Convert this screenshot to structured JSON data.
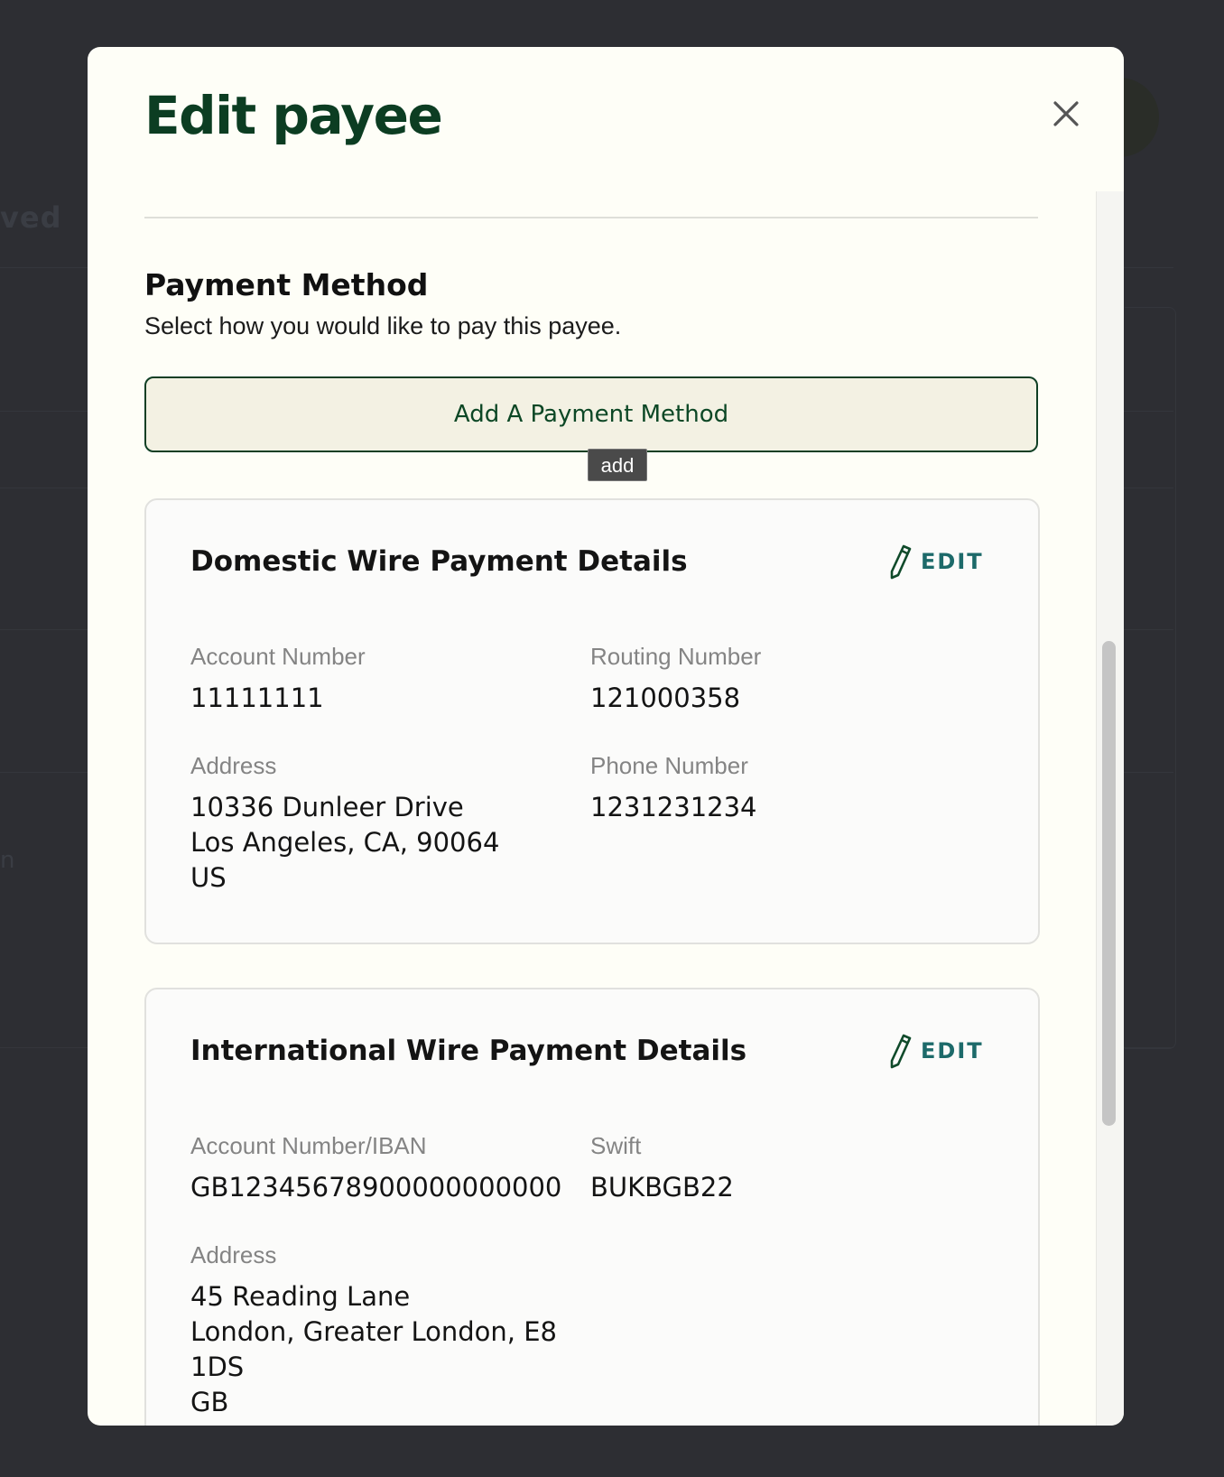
{
  "background": {
    "ghost_text_top": "ved",
    "ghost_text_mid": "n"
  },
  "modal": {
    "title": "Edit payee",
    "close_icon": "close-icon"
  },
  "payment_method": {
    "title": "Payment Method",
    "subtitle": "Select how you would like to pay this payee.",
    "add_button_label": "Add A Payment Method",
    "tooltip": "add"
  },
  "domestic": {
    "title": "Domestic Wire Payment Details",
    "edit_label": "EDIT",
    "account_label": "Account Number",
    "account_value": "11111111",
    "routing_label": "Routing Number",
    "routing_value": "121000358",
    "address_label": "Address",
    "address_line1": "10336 Dunleer Drive",
    "address_line2": "Los Angeles, CA, 90064",
    "address_line3": "US",
    "phone_label": "Phone Number",
    "phone_value": "1231231234"
  },
  "international": {
    "title": "International Wire Payment Details",
    "edit_label": "EDIT",
    "account_label": "Account Number/IBAN",
    "account_value": "GB12345678900000000000",
    "swift_label": "Swift",
    "swift_value": "BUKBGB22",
    "address_label": "Address",
    "address_line1": "45 Reading Lane",
    "address_line2": "London, Greater London, E8",
    "address_line3": "1DS",
    "address_line4": "GB"
  },
  "colors": {
    "backdrop": "#2d2e33",
    "modal_bg": "#fefef7",
    "brand_green": "#0c3d22",
    "edit_teal": "#1d6a6a"
  }
}
